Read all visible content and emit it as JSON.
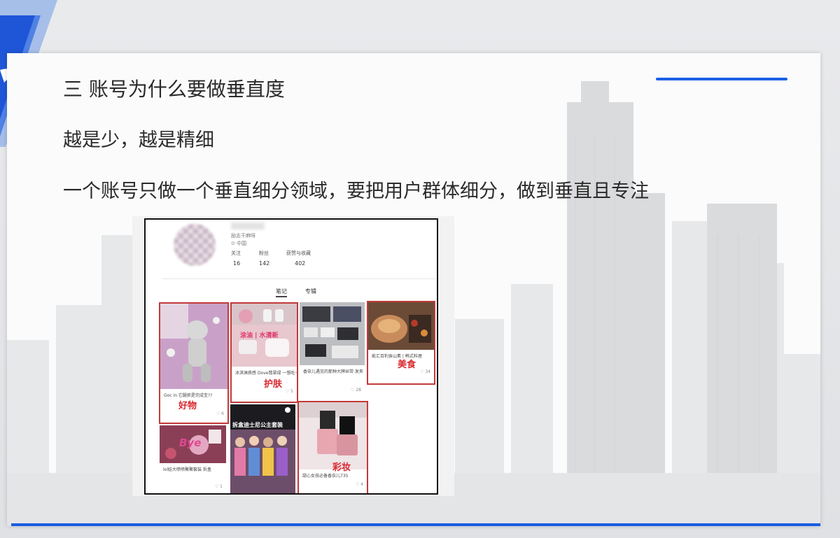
{
  "slide": {
    "title": "三  账号为什么要做垂直度",
    "subtitle": "越是少，越是精细",
    "body": "一个账号只做一个垂直细分领域，要把用户群体细分，做到垂直且专注"
  },
  "profile": {
    "bio_line": "励志干麻呀",
    "location": "中国",
    "stats": [
      {
        "label": "关注",
        "value": "16"
      },
      {
        "label": "粉丝",
        "value": "142"
      },
      {
        "label": "获赞与收藏",
        "value": "402"
      }
    ],
    "tabs": [
      "笔记",
      "专辑"
    ]
  },
  "notes": [
    {
      "tag": "好物",
      "caption": "Goc in 它腿抓是完成宝??",
      "likes": "6"
    },
    {
      "tag": "护肤",
      "overlay": "涂油 | 水清新",
      "caption": "冰淇淋质感 Dove翡翠绿 一想吃一口",
      "likes": "5"
    },
    {
      "tag": "",
      "caption": "香奈儿遇见的那种大牌丝带 发夹",
      "likes": "28"
    },
    {
      "tag": "美食",
      "caption": "能汇百利食山素 | 韩式料理",
      "likes": "34"
    },
    {
      "tag": "",
      "overlay": "Bye",
      "caption": "lol娃大喷喷聚聚套装 拆盒",
      "likes": "1"
    },
    {
      "tag": "",
      "overlay": "拆盒迪士尼公主套装",
      "caption": "",
      "likes": ""
    },
    {
      "tag": "彩妆",
      "caption": "甜心女孩必备香奈儿735",
      "likes": "4"
    }
  ],
  "colors": {
    "accent": "#1c5fe6",
    "highlight": "#c23a3a",
    "tag_text": "#d9282f"
  }
}
